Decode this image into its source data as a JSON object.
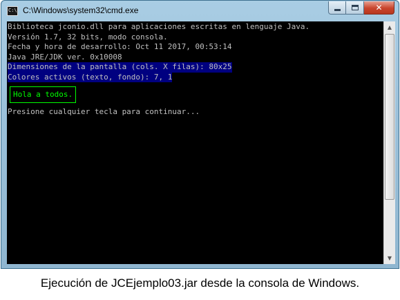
{
  "window": {
    "title": "C:\\Windows\\system32\\cmd.exe",
    "icon_text": "C:\\",
    "close_glyph": "✕"
  },
  "console": {
    "lines": [
      "Biblioteca jconio.dll para aplicaciones escritas en lenguaje Java.",
      "Versión 1.7, 32 bits, modo consola.",
      "Fecha y hora de desarrollo: Oct 11 2017, 00:53:14",
      "Java JRE/JDK ver. 0x10008",
      "Dimensiones de la pantalla (cols. X filas): 80x25",
      "Colores activos (texto, fondo): 7, 1"
    ],
    "hello": "Hola a todos.",
    "prompt": "Presione cualquier tecla para continuar..."
  },
  "scrollbar": {
    "up_glyph": "▲",
    "down_glyph": "▼"
  },
  "caption": "Ejecución de JCEjemplo03.jar desde la consola de Windows.",
  "colors": {
    "console_bg": "#000000",
    "console_text": "#c0c0c0",
    "highlight_bg": "#000080",
    "hello_green": "#00ff00",
    "close_red": "#c8442c"
  }
}
